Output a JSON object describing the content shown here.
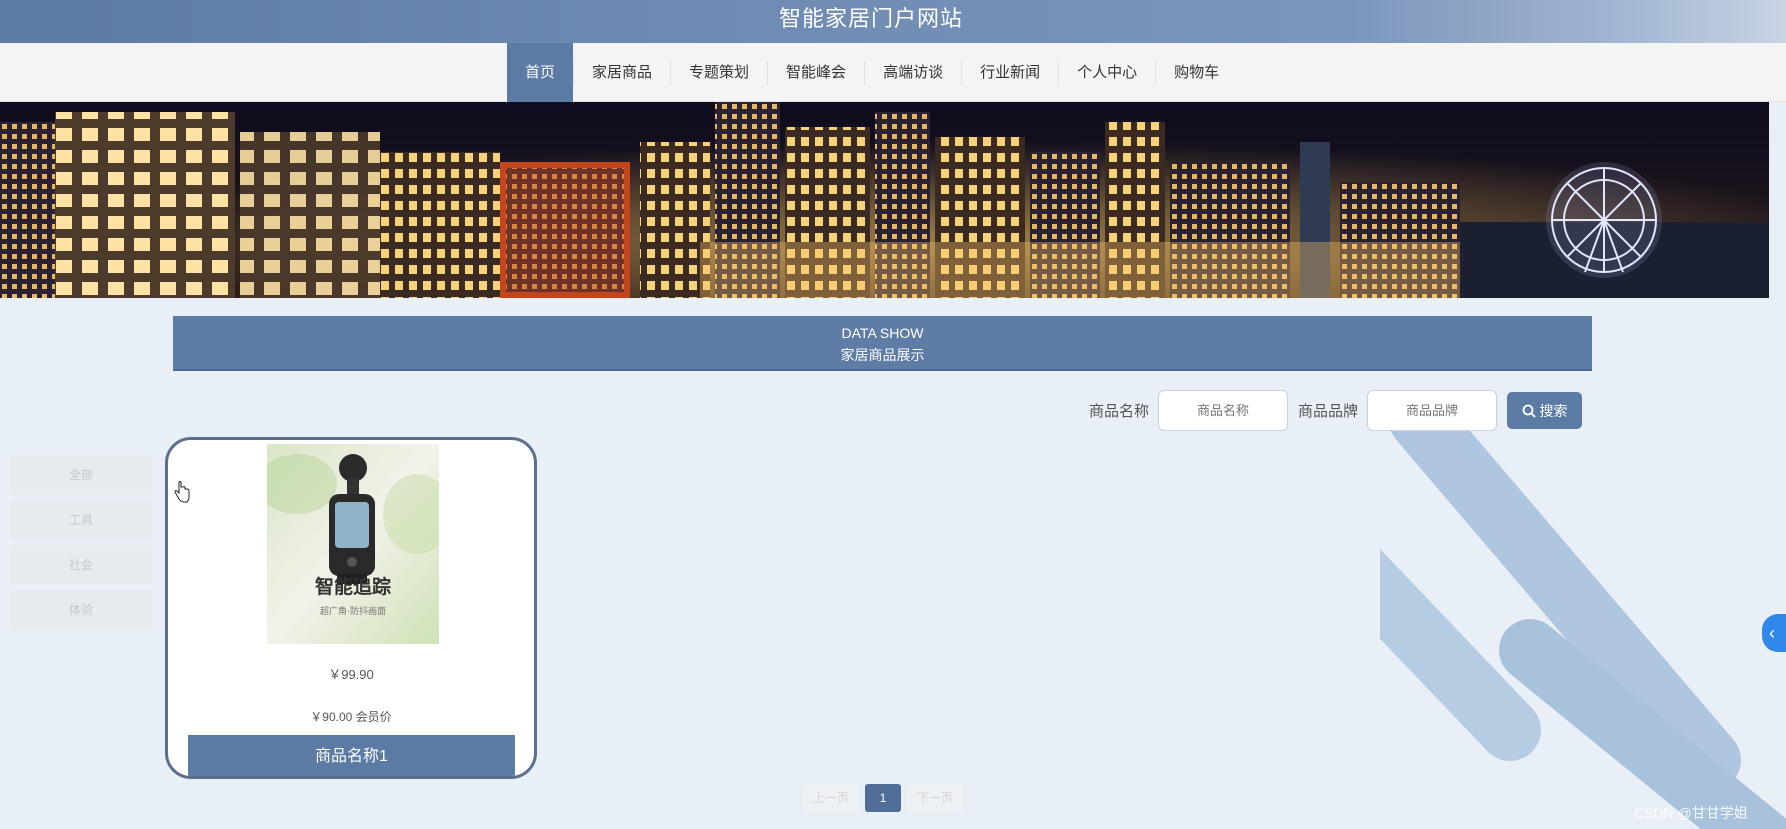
{
  "header": {
    "title": "智能家居门户网站"
  },
  "nav": {
    "items": [
      {
        "label": "首页",
        "active": true
      },
      {
        "label": "家居商品"
      },
      {
        "label": "专题策划"
      },
      {
        "label": "智能峰会"
      },
      {
        "label": "高端访谈"
      },
      {
        "label": "行业新闻"
      },
      {
        "label": "个人中心"
      },
      {
        "label": "购物车"
      }
    ]
  },
  "section": {
    "title_en": "DATA SHOW",
    "title_cn": "家居商品展示"
  },
  "search": {
    "name_label": "商品名称",
    "name_placeholder": "商品名称",
    "brand_label": "商品品牌",
    "brand_placeholder": "商品品牌",
    "button_label": "搜索"
  },
  "categories": [
    "全部",
    "工具",
    "社会",
    "体验"
  ],
  "product": {
    "image_caption": "智能追踪",
    "image_subcaption": "超广角·防抖画面",
    "price": "￥99.90",
    "vip_price": "￥90.00",
    "vip_label": "会员价",
    "name": "商品名称1"
  },
  "pagination": {
    "prev": "上一页",
    "current": "1",
    "next": "下一页"
  },
  "watermark": "CSDN @甘甘学姐",
  "colors": {
    "primary": "#5b7aa4",
    "header_gradient_start": "#5d7aa3",
    "background": "#e9eff7"
  }
}
